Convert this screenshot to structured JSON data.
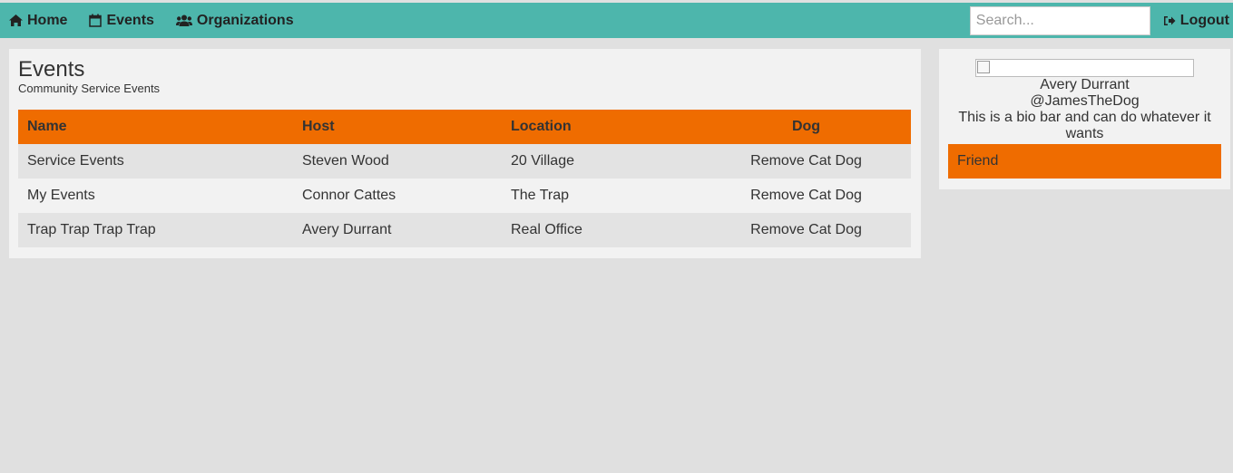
{
  "nav": {
    "home_label": "Home",
    "events_label": "Events",
    "organizations_label": "Organizations",
    "search_placeholder": "Search...",
    "logout_label": "Logout",
    "background_color": "#4db6ac"
  },
  "main": {
    "title": "Events",
    "subtitle": "Community Service Events",
    "table": {
      "header_color": "#ef6c00",
      "columns": [
        "Name",
        "Host",
        "Location",
        "Dog"
      ],
      "rows": [
        [
          "Service Events",
          "Steven Wood",
          "20 Village",
          "Remove Cat Dog"
        ],
        [
          "My Events",
          "Connor Cattes",
          "The Trap",
          "Remove Cat Dog"
        ],
        [
          "Trap Trap Trap Trap",
          "Avery Durrant",
          "Real Office",
          "Remove Cat Dog"
        ]
      ]
    }
  },
  "profile": {
    "name": "Avery Durrant",
    "handle": "@JamesTheDog",
    "bio": "This is a bio bar and can do whatever it wants",
    "friend_label": "Friend"
  }
}
